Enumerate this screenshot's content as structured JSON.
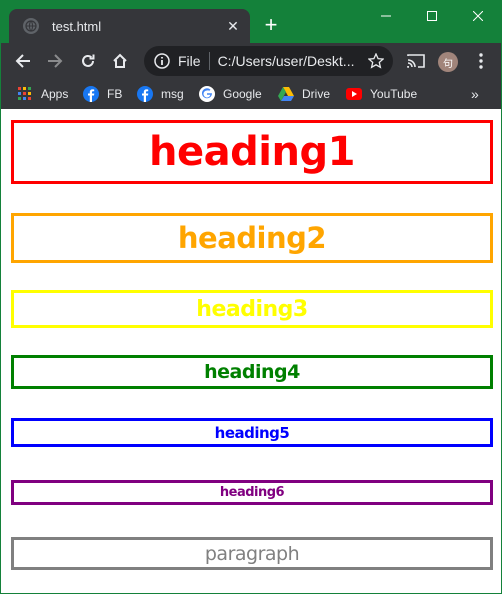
{
  "browser": {
    "tab_title": "test.html",
    "tab_close": "✕",
    "new_tab": "+",
    "url_scheme": "File",
    "url": "C:/Users/user/Deskt...",
    "profile_initial": "句"
  },
  "bookmarks": [
    {
      "label": "Apps"
    },
    {
      "label": "FB"
    },
    {
      "label": "msg"
    },
    {
      "label": "Google"
    },
    {
      "label": "Drive"
    },
    {
      "label": "YouTube"
    }
  ],
  "bookmarks_more": "»",
  "page": {
    "h1": "heading1",
    "h2": "heading2",
    "h3": "heading3",
    "h4": "heading4",
    "h5": "heading5",
    "h6": "heading6",
    "p": "paragraph"
  },
  "colors": {
    "titlebar": "#14813a",
    "h1": "#ff0000",
    "h2": "#ffa500",
    "h3": "#ffff00",
    "h4": "#008000",
    "h5": "#0000ff",
    "h6": "#800080",
    "p": "#808080"
  }
}
